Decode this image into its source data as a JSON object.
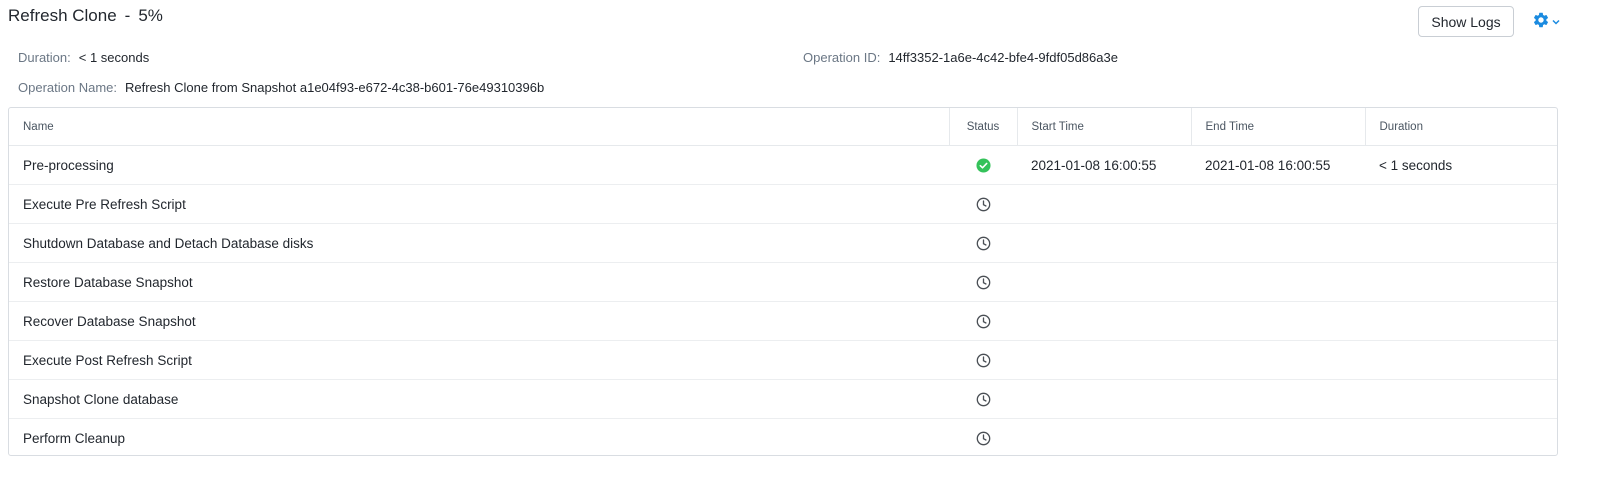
{
  "header": {
    "operation_title": "Refresh Clone",
    "separator": "-",
    "progress_text": "5%",
    "show_logs_label": "Show Logs",
    "settings_icon": "gear-icon"
  },
  "details": {
    "duration_label": "Duration:",
    "duration_value": "< 1 seconds",
    "operation_id_label": "Operation ID:",
    "operation_id_value": "14ff3352-1a6e-4c42-bfe4-9fdf05d86a3e",
    "operation_name_label": "Operation Name:",
    "operation_name_value": "Refresh Clone from Snapshot a1e04f93-e672-4c38-b601-76e49310396b"
  },
  "table": {
    "columns": {
      "name": "Name",
      "status": "Status",
      "start_time": "Start Time",
      "end_time": "End Time",
      "duration": "Duration"
    },
    "rows": [
      {
        "name": "Pre-processing",
        "status": "completed",
        "start_time": "2021-01-08 16:00:55",
        "end_time": "2021-01-08 16:00:55",
        "duration": "< 1 seconds"
      },
      {
        "name": "Execute Pre Refresh Script",
        "status": "pending",
        "start_time": "",
        "end_time": "",
        "duration": ""
      },
      {
        "name": "Shutdown Database and Detach Database disks",
        "status": "pending",
        "start_time": "",
        "end_time": "",
        "duration": ""
      },
      {
        "name": "Restore Database Snapshot",
        "status": "pending",
        "start_time": "",
        "end_time": "",
        "duration": ""
      },
      {
        "name": "Recover Database Snapshot",
        "status": "pending",
        "start_time": "",
        "end_time": "",
        "duration": ""
      },
      {
        "name": "Execute Post Refresh Script",
        "status": "pending",
        "start_time": "",
        "end_time": "",
        "duration": ""
      },
      {
        "name": "Snapshot Clone database",
        "status": "pending",
        "start_time": "",
        "end_time": "",
        "duration": ""
      },
      {
        "name": "Perform Cleanup",
        "status": "pending",
        "start_time": "",
        "end_time": "",
        "duration": ""
      }
    ]
  },
  "colors": {
    "success": "#34c25a",
    "accent": "#1b8be0",
    "pending_icon": "#4a4f55"
  }
}
